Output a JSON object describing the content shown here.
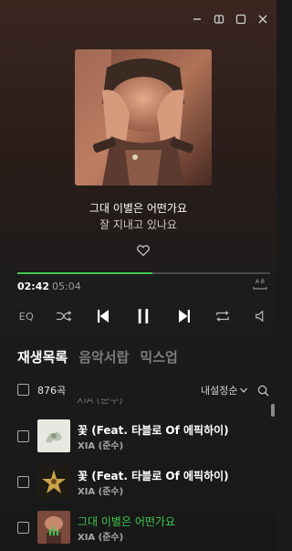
{
  "now_playing": {
    "title": "그대 이별은 어떤가요",
    "artist": "잘 지내고 있나요",
    "current_time": "02:42",
    "total_time": "05:04",
    "progress": 0.534,
    "ab_label": "A B"
  },
  "controls": {
    "eq_label": "EQ"
  },
  "tabs": [
    {
      "label": "재생목록",
      "active": true
    },
    {
      "label": "음악서랍",
      "active": false
    },
    {
      "label": "믹스업",
      "active": false
    }
  ],
  "list_header": {
    "count": "876곡",
    "sort_label": "내설정순"
  },
  "partial_row_artist": "XIA (준수)",
  "tracks": [
    {
      "title": "꽃 (Feat. 타블로 Of 에픽하이)",
      "artist": "XIA (준수)",
      "playing": false
    },
    {
      "title": "꽃 (Feat. 타블로 Of 에픽하이)",
      "artist": "XIA (준수)",
      "playing": false
    },
    {
      "title": "그대 이별은 어떤가요",
      "artist": "XIA (준수)",
      "playing": true
    }
  ],
  "colors": {
    "accent": "#3ec84e",
    "background": "#181818"
  }
}
